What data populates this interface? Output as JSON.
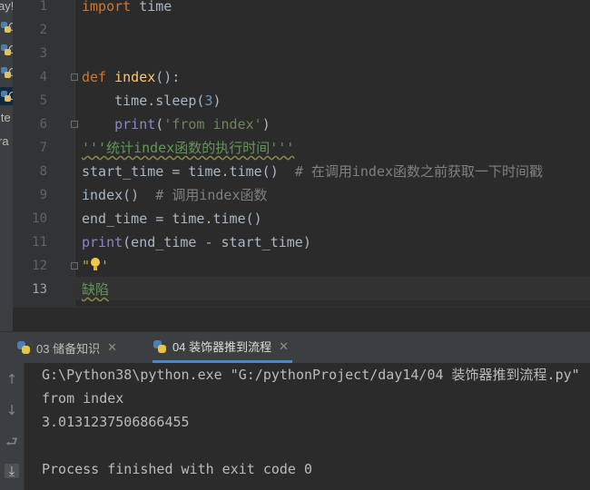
{
  "editor": {
    "lines": [
      {
        "number": "1",
        "segments": [
          {
            "t": "kw",
            "v": "import"
          },
          {
            "t": "plain",
            "v": " time"
          }
        ]
      },
      {
        "number": "2",
        "segments": []
      },
      {
        "number": "3",
        "segments": []
      },
      {
        "number": "4",
        "segments": [
          {
            "t": "kw",
            "v": "def"
          },
          {
            "t": "plain",
            "v": " "
          },
          {
            "t": "fn",
            "v": "index"
          },
          {
            "t": "plain",
            "v": "():"
          }
        ]
      },
      {
        "number": "5",
        "segments": [
          {
            "t": "plain",
            "v": "    time.sleep("
          },
          {
            "t": "num",
            "v": "3"
          },
          {
            "t": "plain",
            "v": ")"
          }
        ]
      },
      {
        "number": "6",
        "segments": [
          {
            "t": "plain",
            "v": "    "
          },
          {
            "t": "builtin",
            "v": "print"
          },
          {
            "t": "plain",
            "v": "("
          },
          {
            "t": "str",
            "v": "'from index'"
          },
          {
            "t": "plain",
            "v": ")"
          }
        ]
      },
      {
        "number": "7",
        "segments": [
          {
            "t": "doc",
            "v": "'''统计index函数的执行时间'''"
          }
        ]
      },
      {
        "number": "8",
        "segments": [
          {
            "t": "plain",
            "v": "start_time = time.time()  "
          },
          {
            "t": "comment",
            "v": "# 在调用index函数之前获取一下时间戳"
          }
        ]
      },
      {
        "number": "9",
        "segments": [
          {
            "t": "plain",
            "v": "index()  "
          },
          {
            "t": "comment",
            "v": "# 调用index函数"
          }
        ]
      },
      {
        "number": "10",
        "segments": [
          {
            "t": "plain",
            "v": "end_time = time.time()"
          }
        ]
      },
      {
        "number": "11",
        "segments": [
          {
            "t": "builtin",
            "v": "print"
          },
          {
            "t": "plain",
            "v": "(end_time - start_time)"
          }
        ]
      },
      {
        "number": "12",
        "segments": [
          {
            "t": "warn",
            "v": "\""
          },
          {
            "t": "bulb",
            "v": ""
          },
          {
            "t": "warn",
            "v": "'"
          }
        ]
      },
      {
        "number": "13",
        "segments": [
          {
            "t": "doc",
            "v": "缺陷"
          }
        ]
      }
    ],
    "current_line": "13"
  },
  "left_panel": {
    "rows": [
      {
        "text": "ay!",
        "icon": false
      },
      {
        "text": "C",
        "icon": true
      },
      {
        "text": "C",
        "icon": true
      },
      {
        "text": "C",
        "icon": true
      },
      {
        "text": "C",
        "icon": true
      },
      {
        "text": "ite",
        "icon": false
      },
      {
        "text": "ra",
        "icon": false
      }
    ]
  },
  "run": {
    "tabs": [
      {
        "label": "03 储备知识",
        "close": "✕",
        "active": false
      },
      {
        "label": "04 装饰器推到流程",
        "close": "✕",
        "active": true
      }
    ],
    "toolbar": [
      {
        "icon": "arrow-up-icon",
        "glyph": "↑"
      },
      {
        "icon": "arrow-down-icon",
        "glyph": "↓"
      },
      {
        "icon": "soft-wrap-icon",
        "glyph": "⮐"
      },
      {
        "icon": "scroll-to-end-icon",
        "glyph": "⤓"
      }
    ],
    "output": [
      "G:\\Python38\\python.exe \"G:/pythonProject/day14/04 装饰器推到流程.py\"",
      "from index",
      "3.0131237506866455",
      "",
      "Process finished with exit code 0"
    ]
  },
  "colors": {
    "background": "#2b2b2b",
    "keyword": "#cc7832",
    "function": "#ffc66d",
    "string": "#6a8759",
    "number": "#6897bb",
    "comment": "#808080",
    "accent": "#4a88c7"
  }
}
